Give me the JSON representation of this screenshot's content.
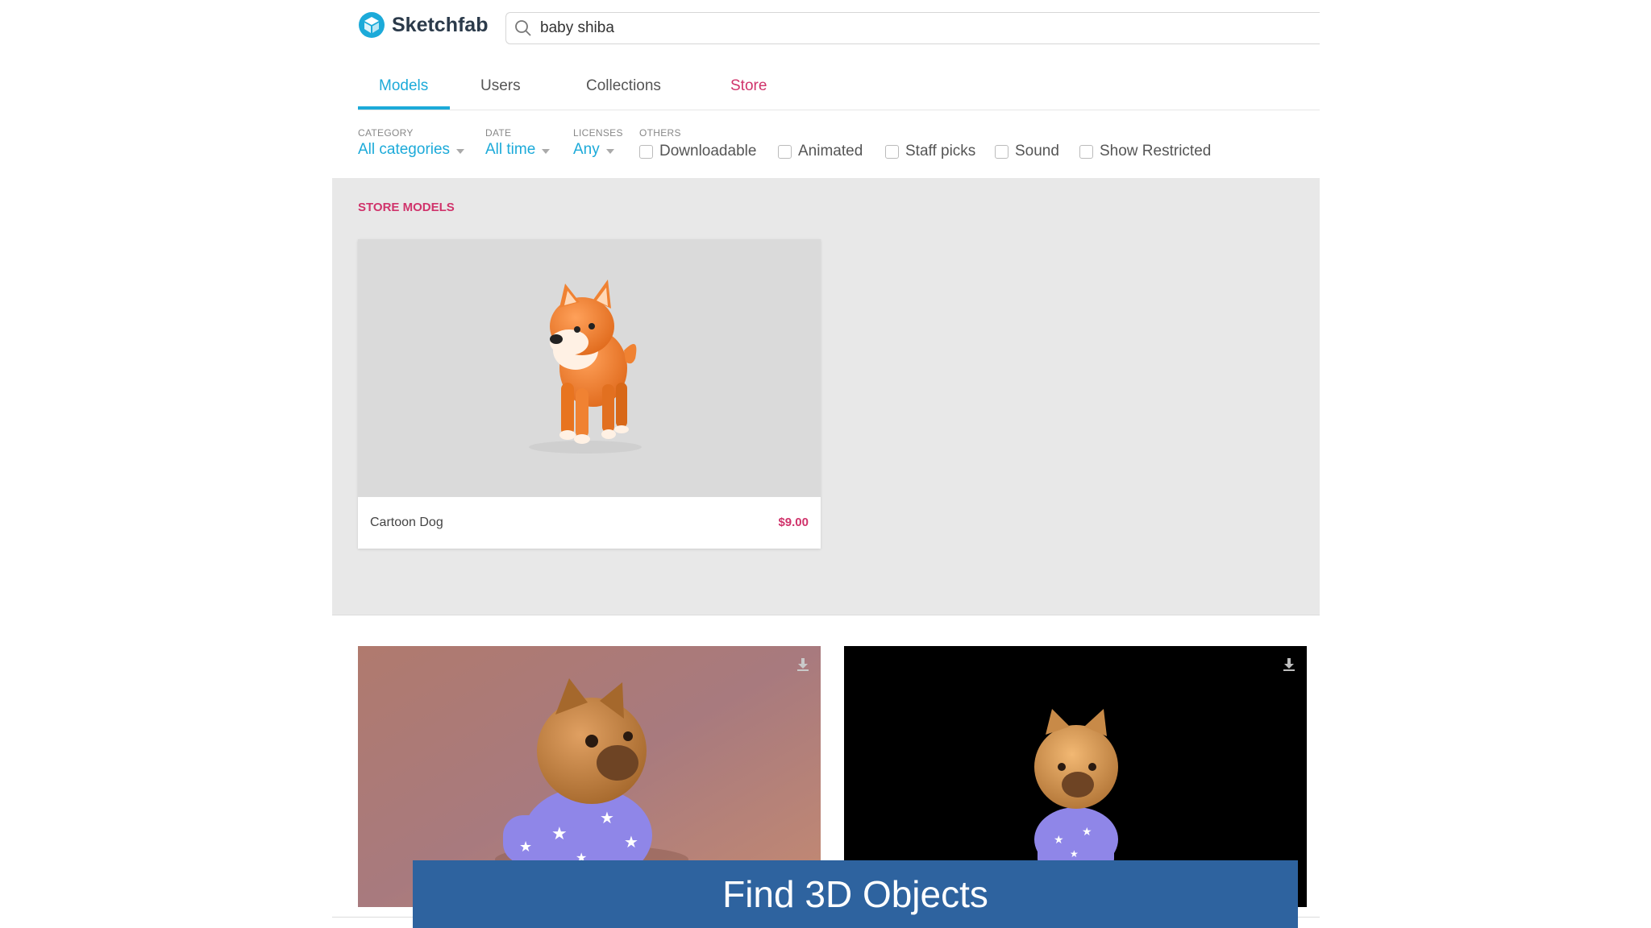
{
  "header": {
    "logo_text": "Sketchfab",
    "search_value": "baby shiba",
    "search_icon": "search-icon"
  },
  "tabs": [
    {
      "label": "Models",
      "active": true
    },
    {
      "label": "Users"
    },
    {
      "label": "Collections"
    },
    {
      "label": "Store"
    }
  ],
  "filters": {
    "category": {
      "label": "CATEGORY",
      "value": "All categories"
    },
    "date": {
      "label": "DATE",
      "value": "All time"
    },
    "licenses": {
      "label": "LICENSES",
      "value": "Any"
    },
    "others": {
      "label": "OTHERS"
    },
    "checkboxes": [
      "Downloadable",
      "Animated",
      "Staff picks",
      "Sound",
      "Show Restricted"
    ]
  },
  "store": {
    "title": "STORE MODELS",
    "card": {
      "name": "Cartoon Dog",
      "price": "$9.00"
    }
  },
  "results": [
    {
      "icon": "download-icon"
    },
    {
      "icon": "download-icon"
    }
  ],
  "caption": "Find 3D Objects",
  "colors": {
    "accent": "#1caad9",
    "store": "#d0336b",
    "caption_bg": "#2e639f"
  }
}
